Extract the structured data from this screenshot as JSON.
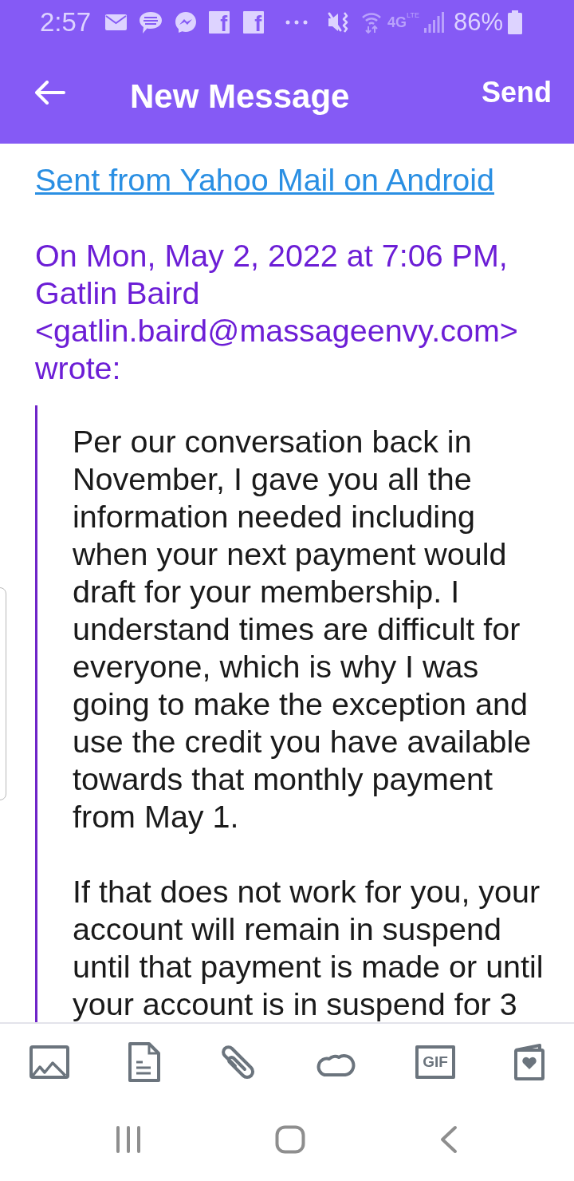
{
  "status_bar": {
    "time": "2:57",
    "notification_letters": [
      "f",
      "f"
    ],
    "network": "4G",
    "network_sub": "LTE",
    "battery": "86%"
  },
  "header": {
    "title": "New Message",
    "action": "Send"
  },
  "body": {
    "signature_link": "Sent from Yahoo Mail on Android",
    "quote_header": [
      "On Mon, May 2, 2022 at 7:06 PM,",
      "Gatlin Baird",
      "<gatlin.baird@massageenvy.com>",
      "wrote:"
    ],
    "quoted_paragraphs": [
      [
        "Per our conversation back in",
        "November, I gave you all the",
        "information needed including",
        "when your next payment would",
        "draft for your membership. I",
        "understand times are difficult for",
        "everyone, which is why I was",
        "going to make the exception and",
        "use the credit you have available",
        "towards that monthly payment",
        "from May 1."
      ],
      [
        "If that does not work for you, your",
        "account will remain in suspend",
        "until that payment is made or until",
        "your account is in suspend for 3"
      ]
    ]
  },
  "toolbar": {
    "gif_label": "GIF"
  }
}
